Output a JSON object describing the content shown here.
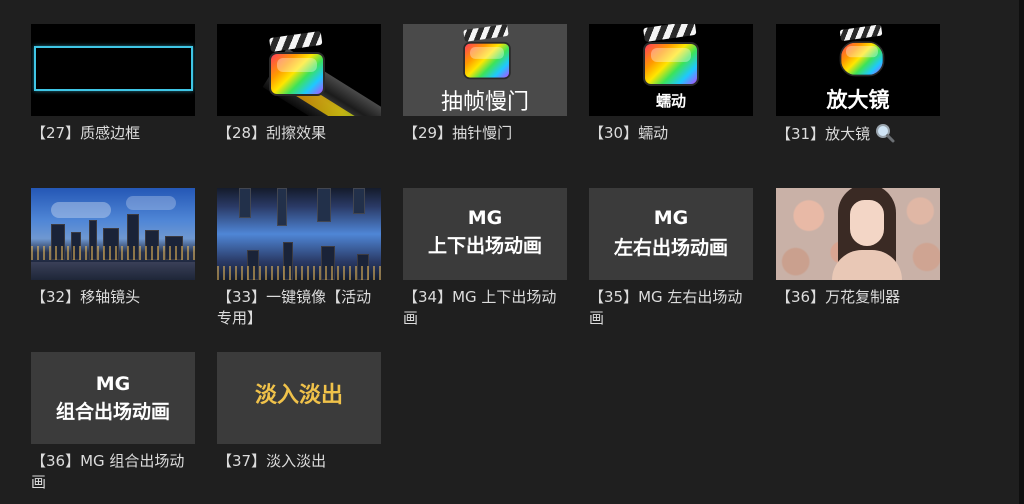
{
  "effects": [
    {
      "caption": "【27】质感边框",
      "thumb_text": ""
    },
    {
      "caption": "【28】刮擦效果",
      "thumb_text": ""
    },
    {
      "caption": "【29】抽针慢门",
      "thumb_text": "抽帧慢门"
    },
    {
      "caption": "【30】蠕动",
      "thumb_text": "蠕动"
    },
    {
      "caption": "【31】放大镜",
      "thumb_text": "放大镜",
      "caption_icon": "magnifier-icon"
    },
    {
      "caption": "【32】移轴镜头",
      "thumb_text": ""
    },
    {
      "caption": "【33】一键镜像【活动专用】",
      "thumb_text": ""
    },
    {
      "caption": "【34】MG 上下出场动画",
      "thumb_line1": "MG",
      "thumb_line2": "上下出场动画"
    },
    {
      "caption": "【35】MG 左右出场动画",
      "thumb_line1": "MG",
      "thumb_line2": "左右出场动画"
    },
    {
      "caption": "【36】万花复制器",
      "thumb_text": ""
    },
    {
      "caption": "【36】MG 组合出场动画",
      "thumb_line1": "MG",
      "thumb_line2": "组合出场动画"
    },
    {
      "caption": "【37】淡入淡出",
      "thumb_text": "淡入淡出"
    }
  ],
  "colors": {
    "background": "#1f1f1f",
    "tile_gray": "#3b3b3b",
    "caption_text": "#dcdcdc",
    "frame_border": "#3fc6e6",
    "fade_text": "#f0c24a"
  }
}
